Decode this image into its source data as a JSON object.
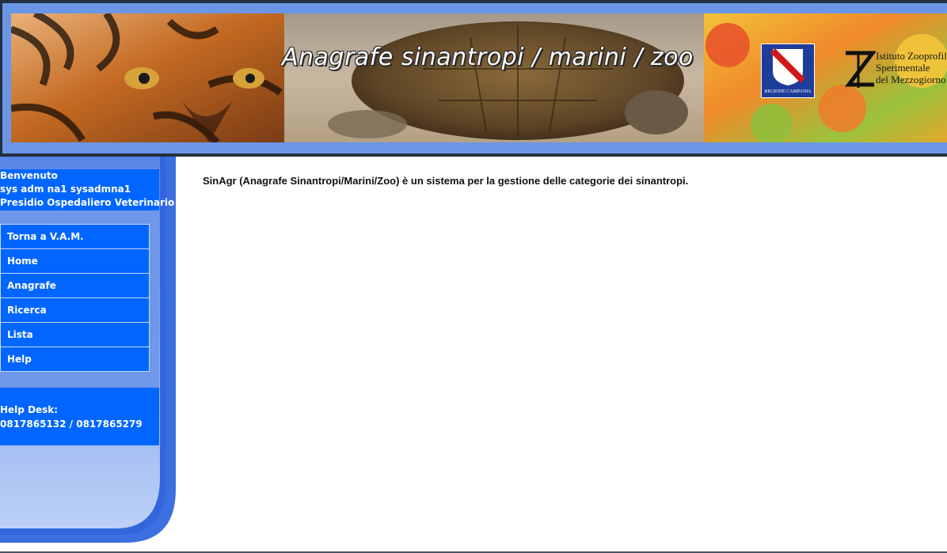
{
  "header": {
    "banner_title": "Anagrafe sinantropi /  marini / zoo",
    "region_logo_label": "REGIONE CAMPANIA",
    "institute_logo": {
      "line1": "Istituto Zooprofilattico",
      "line2": "Sperimentale",
      "line3": "del Mezzogiorno"
    }
  },
  "sidebar": {
    "welcome": {
      "greeting": "Benvenuto",
      "user": "sys adm na1 sysadmna1",
      "role": "Presidio Ospedaliero Veterinario"
    },
    "menu": [
      {
        "label": "Torna a V.A.M."
      },
      {
        "label": "Home"
      },
      {
        "label": "Anagrafe"
      },
      {
        "label": "Ricerca"
      },
      {
        "label": "Lista"
      },
      {
        "label": "Help"
      }
    ],
    "helpdesk": {
      "label": "Help Desk:",
      "phones": "0817865132 / 0817865279"
    }
  },
  "main": {
    "description": "SinAgr (Anagrafe Sinantropi/Marini/Zoo) è un sistema per la gestione delle categorie dei sinantropi."
  },
  "colors": {
    "menu_blue": "#0066ff",
    "frame_blue": "#6b96e6",
    "header_dark": "#243041"
  }
}
